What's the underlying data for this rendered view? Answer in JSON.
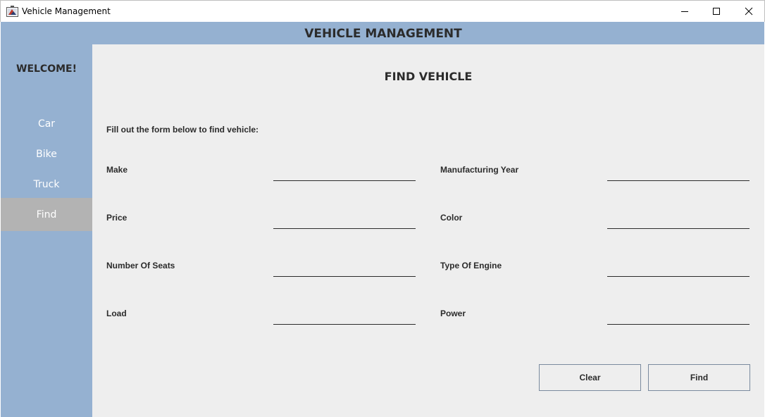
{
  "window": {
    "title": "Vehicle Management",
    "icon": "java-app-icon"
  },
  "header": {
    "title": "VEHICLE MANAGEMENT",
    "background": "#95b1d1"
  },
  "sidebar": {
    "welcome": "WELCOME!",
    "items": [
      {
        "label": "Car",
        "selected": false
      },
      {
        "label": "Bike",
        "selected": false
      },
      {
        "label": "Truck",
        "selected": false
      },
      {
        "label": "Find",
        "selected": true
      }
    ],
    "selected_background": "#b3b3b3"
  },
  "main": {
    "title": "FIND VEHICLE",
    "instruction": "Fill out the form below to find vehicle:",
    "fields": {
      "make": {
        "label": "Make",
        "value": ""
      },
      "manufacturing_year": {
        "label": "Manufacturing Year",
        "value": ""
      },
      "price": {
        "label": "Price",
        "value": ""
      },
      "color": {
        "label": "Color",
        "value": ""
      },
      "number_of_seats": {
        "label": "Number Of Seats",
        "value": ""
      },
      "type_of_engine": {
        "label": "Type Of Engine",
        "value": ""
      },
      "load": {
        "label": "Load",
        "value": ""
      },
      "power": {
        "label": "Power",
        "value": ""
      }
    },
    "buttons": {
      "clear": "Clear",
      "find": "Find"
    }
  }
}
